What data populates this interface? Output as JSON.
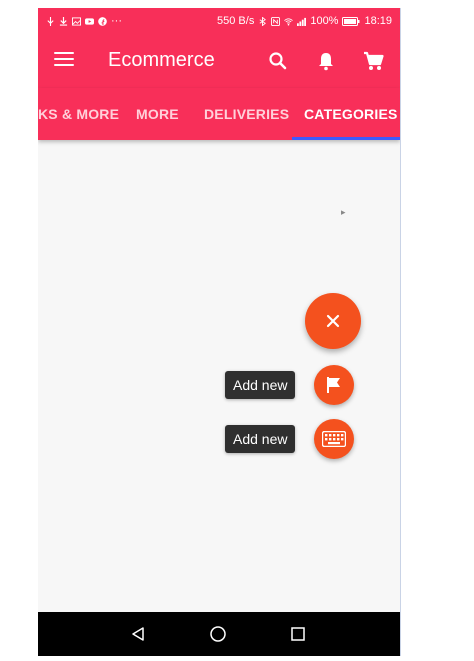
{
  "status": {
    "left_icons": [
      "usb-icon",
      "download-icon",
      "image-icon",
      "youtube-icon",
      "facebook-icon"
    ],
    "overflow": "···",
    "speed": "550 B/s",
    "battery_percent": "100%",
    "time": "18:19"
  },
  "appbar": {
    "title": "Ecommerce"
  },
  "tabs": [
    {
      "label": "KS & MORE"
    },
    {
      "label": "MORE"
    },
    {
      "label": "DELIVERIES"
    },
    {
      "label": "CATEGORIES",
      "active": true
    }
  ],
  "fab": {
    "main_icon": "close-icon",
    "actions": [
      {
        "label": "Add new",
        "icon": "flag-icon"
      },
      {
        "label": "Add new",
        "icon": "keyboard-icon"
      }
    ]
  },
  "colors": {
    "primary": "#f82f59",
    "accent": "#f4511e",
    "indicator": "#3d5afe",
    "label_bg": "#2f2f2f"
  }
}
